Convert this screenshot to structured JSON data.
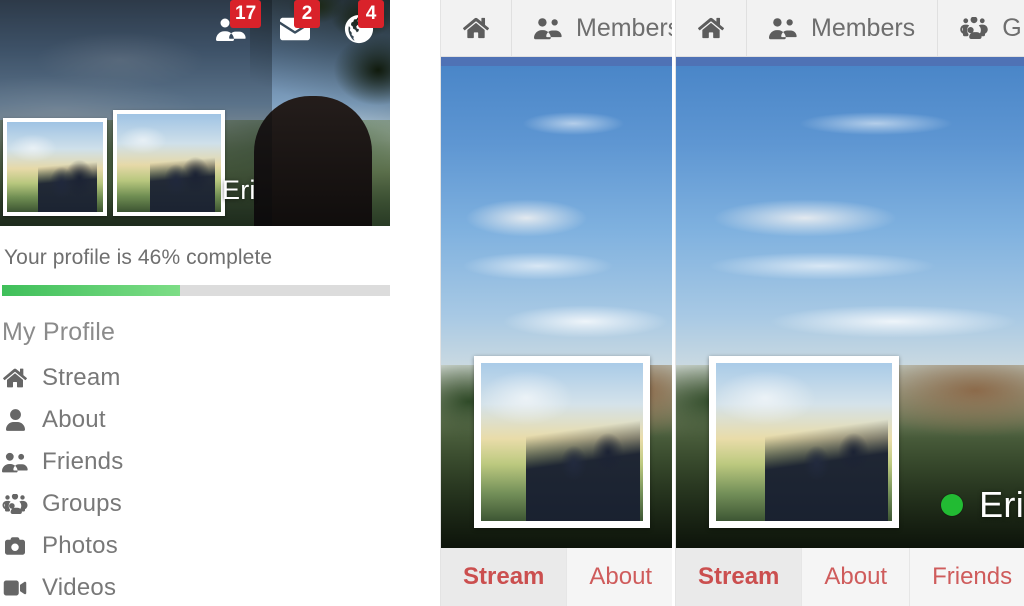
{
  "left_panel": {
    "cover": {
      "display_name": "Eri",
      "notifications": [
        {
          "icon": "friends-icon",
          "count": "17"
        },
        {
          "icon": "envelope-icon",
          "count": "2"
        },
        {
          "icon": "globe-icon",
          "count": "4"
        }
      ]
    },
    "profile_completion": {
      "text": "Your profile is 46% complete",
      "percent": 46,
      "fill_color": "#3fbf5a",
      "track_color": "#dcdcdc"
    },
    "sidebar": {
      "title": "My Profile",
      "items": [
        {
          "icon": "home-icon",
          "label": "Stream"
        },
        {
          "icon": "user-icon",
          "label": "About"
        },
        {
          "icon": "friends-icon",
          "label": "Friends"
        },
        {
          "icon": "groups-icon",
          "label": "Groups"
        },
        {
          "icon": "camera-icon",
          "label": "Photos"
        },
        {
          "icon": "video-icon",
          "label": "Videos"
        }
      ]
    }
  },
  "middle_panel": {
    "navbar": {
      "items": [
        {
          "icon": "home-icon",
          "label": ""
        },
        {
          "icon": "friends-icon",
          "label": "Members"
        }
      ],
      "accent_color": "#4f72b5"
    },
    "tabs": [
      {
        "label": "Stream",
        "active": true
      },
      {
        "label": "About",
        "active": false
      }
    ]
  },
  "right_panel": {
    "navbar": {
      "items": [
        {
          "icon": "home-icon",
          "label": ""
        },
        {
          "icon": "friends-icon",
          "label": "Members"
        },
        {
          "icon": "groups-icon",
          "label": "G"
        }
      ],
      "accent_color": "#4f72b5"
    },
    "cover": {
      "display_name": "Eri",
      "status": "online",
      "status_color": "#22bb33"
    },
    "tabs": [
      {
        "label": "Stream",
        "active": true
      },
      {
        "label": "About",
        "active": false
      },
      {
        "label": "Friends",
        "active": false
      }
    ]
  }
}
